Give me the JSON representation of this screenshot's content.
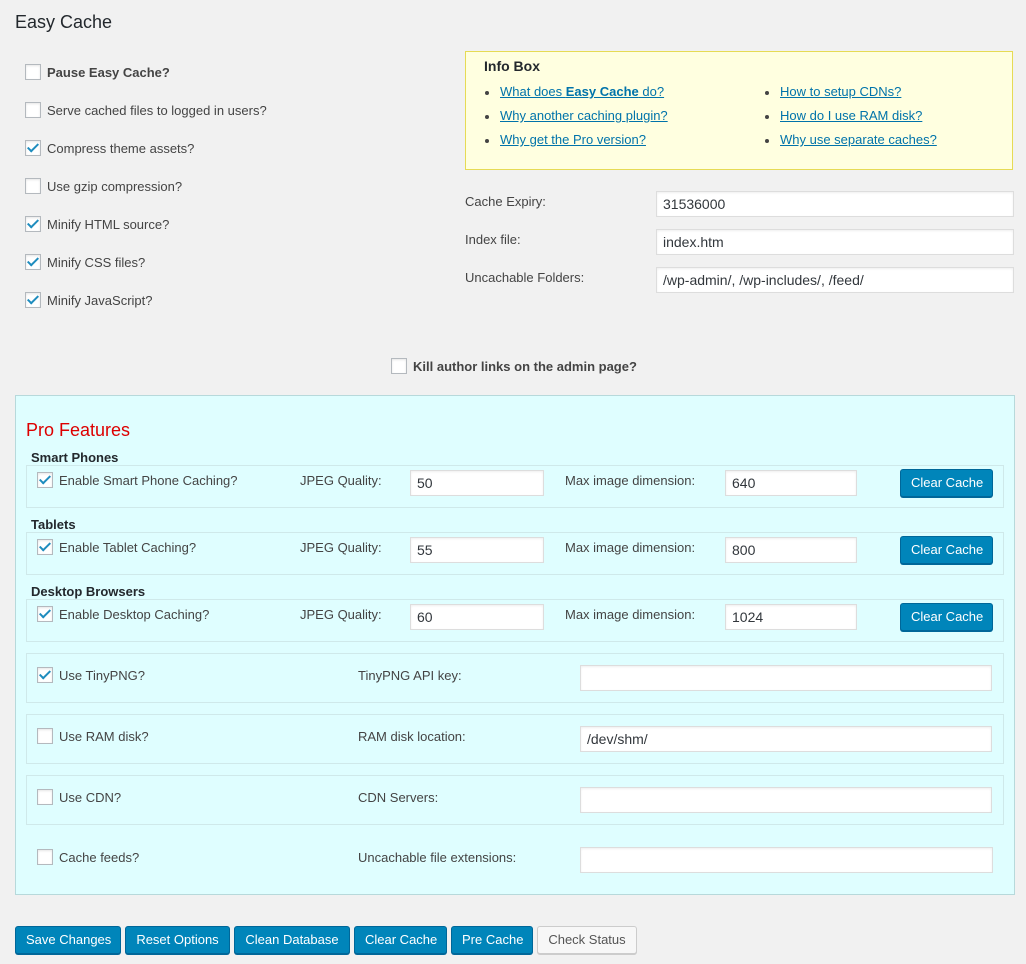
{
  "page": {
    "title": "Easy Cache"
  },
  "options": {
    "pause": {
      "label": "Pause Easy Cache?",
      "checked": false
    },
    "serve_logged_in": {
      "label": "Serve cached files to logged in users?",
      "checked": false
    },
    "compress_assets": {
      "label": "Compress theme assets?",
      "checked": true
    },
    "gzip": {
      "label": "Use gzip compression?",
      "checked": false
    },
    "minify_html": {
      "label": "Minify HTML source?",
      "checked": true
    },
    "minify_css": {
      "label": "Minify CSS files?",
      "checked": true
    },
    "minify_js": {
      "label": "Minify JavaScript?",
      "checked": true
    }
  },
  "infobox": {
    "title": "Info Box",
    "links": {
      "what_does_prefix": "What does ",
      "what_does_bold": "Easy Cache",
      "what_does_suffix": " do?",
      "why_another": "Why another caching plugin?",
      "why_pro": "Why get the Pro version?",
      "cdn_setup": "How to setup CDNs?",
      "ram_disk": "How do I use RAM disk?",
      "separate_caches": "Why use separate caches?"
    }
  },
  "settings": {
    "cache_expiry": {
      "label": "Cache Expiry:",
      "value": "31536000"
    },
    "index_file": {
      "label": "Index file:",
      "value": "index.htm"
    },
    "uncachable_folders": {
      "label": "Uncachable Folders:",
      "value": "/wp-admin/, /wp-includes/, /feed/"
    }
  },
  "kill_author": {
    "label": "Kill author links on the admin page?",
    "checked": false
  },
  "pro": {
    "title": "Pro Features",
    "smart_phones": {
      "title": "Smart Phones",
      "enable_label": "Enable Smart Phone Caching?",
      "enabled": true,
      "jpeg_label": "JPEG Quality:",
      "jpeg_value": "50",
      "dim_label": "Max image dimension:",
      "dim_value": "640",
      "clear_label": "Clear Cache"
    },
    "tablets": {
      "title": "Tablets",
      "enable_label": "Enable Tablet Caching?",
      "enabled": true,
      "jpeg_label": "JPEG Quality:",
      "jpeg_value": "55",
      "dim_label": "Max image dimension:",
      "dim_value": "800",
      "clear_label": "Clear Cache"
    },
    "desktop": {
      "title": "Desktop Browsers",
      "enable_label": "Enable Desktop Caching?",
      "enabled": true,
      "jpeg_label": "JPEG Quality:",
      "jpeg_value": "60",
      "dim_label": "Max image dimension:",
      "dim_value": "1024",
      "clear_label": "Clear Cache"
    },
    "tinypng": {
      "label": "Use TinyPNG?",
      "checked": true,
      "field_label": "TinyPNG API key:",
      "value": ""
    },
    "ramdisk": {
      "label": "Use RAM disk?",
      "checked": false,
      "field_label": "RAM disk location:",
      "value": "/dev/shm/"
    },
    "cdn": {
      "label": "Use CDN?",
      "checked": false,
      "field_label": "CDN Servers:",
      "value": ""
    },
    "feeds": {
      "label": "Cache feeds?",
      "checked": false,
      "field_label": "Uncachable file extensions:",
      "value": ""
    }
  },
  "actions": {
    "save": "Save Changes",
    "reset": "Reset Options",
    "clean_db": "Clean Database",
    "clear_cache": "Clear Cache",
    "pre_cache": "Pre Cache",
    "check_status": "Check Status"
  },
  "colors": {
    "accent": "#0085ba",
    "link": "#0073aa",
    "pro_title": "#dd0000",
    "pro_bg": "#dffeff",
    "infobox_bg": "#ffffe0"
  }
}
